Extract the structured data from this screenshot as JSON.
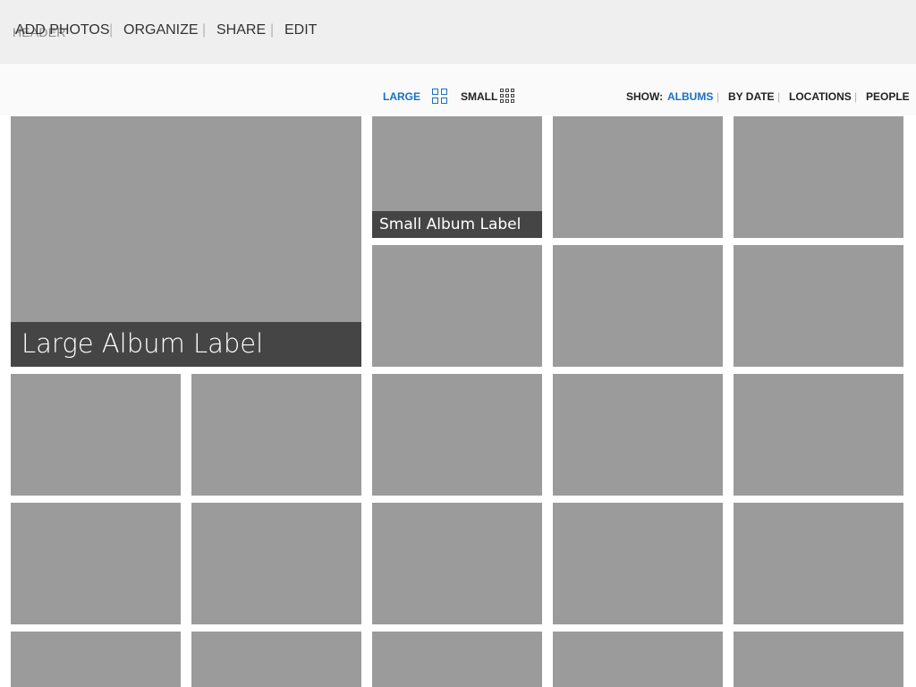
{
  "header": {
    "title": "HEADER"
  },
  "toolbar": {
    "actions": [
      "ADD PHOTOS",
      "ORGANIZE",
      "SHARE",
      "EDIT"
    ],
    "separator": "|",
    "view": {
      "large_label": "LARGE",
      "small_label": "SMALL",
      "selected": "LARGE"
    },
    "show": {
      "label": "SHOW:",
      "options": [
        "ALBUMS",
        "BY DATE",
        "LOCATIONS",
        "PEOPLE"
      ],
      "selected": "ALBUMS"
    }
  },
  "albums": {
    "large_label": "Large Album Label",
    "small_label": "Small Album Label"
  },
  "colors": {
    "accent": "#1a6fc3",
    "tile": "#9b9b9b",
    "label_bg": "#454545",
    "header_bg": "#efefef"
  },
  "icons": {
    "large_grid": "grid-2x2-icon",
    "small_grid": "grid-3x3-icon"
  }
}
